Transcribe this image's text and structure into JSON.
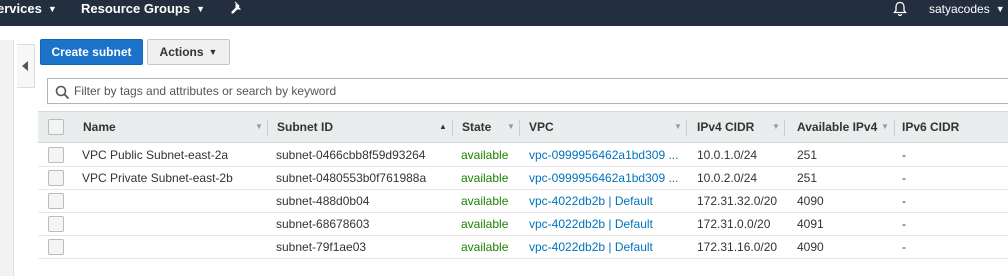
{
  "topnav": {
    "services": "ervices",
    "resource_groups": "Resource Groups",
    "username": "satyacodes"
  },
  "toolbar": {
    "create_label": "Create subnet",
    "actions_label": "Actions"
  },
  "search": {
    "placeholder": "Filter by tags and attributes or search by keyword",
    "value": ""
  },
  "table": {
    "columns": {
      "name": "Name",
      "subnet_id": "Subnet ID",
      "state": "State",
      "vpc": "VPC",
      "ipv4_cidr": "IPv4 CIDR",
      "available_ipv4": "Available IPv4",
      "ipv6_cidr": "IPv6 CIDR"
    },
    "rows": [
      {
        "name": "VPC Public Subnet-east-2a",
        "subnet_id": "subnet-0466cbb8f59d93264",
        "state": "available",
        "vpc": "vpc-0999956462a1bd309 ...",
        "ipv4_cidr": "10.0.1.0/24",
        "available_ipv4": "251",
        "ipv6_cidr": "-"
      },
      {
        "name": "VPC Private Subnet-east-2b",
        "subnet_id": "subnet-0480553b0f761988a",
        "state": "available",
        "vpc": "vpc-0999956462a1bd309 ...",
        "ipv4_cidr": "10.0.2.0/24",
        "available_ipv4": "251",
        "ipv6_cidr": "-"
      },
      {
        "name": "",
        "subnet_id": "subnet-488d0b04",
        "state": "available",
        "vpc": "vpc-4022db2b | Default",
        "ipv4_cidr": "172.31.32.0/20",
        "available_ipv4": "4090",
        "ipv6_cidr": "-"
      },
      {
        "name": "",
        "subnet_id": "subnet-68678603",
        "state": "available",
        "vpc": "vpc-4022db2b | Default",
        "ipv4_cidr": "172.31.0.0/20",
        "available_ipv4": "4091",
        "ipv6_cidr": "-"
      },
      {
        "name": "",
        "subnet_id": "subnet-79f1ae03",
        "state": "available",
        "vpc": "vpc-4022db2b | Default",
        "ipv4_cidr": "172.31.16.0/20",
        "available_ipv4": "4090",
        "ipv6_cidr": "-"
      }
    ]
  },
  "colors": {
    "topbar": "#232f3e",
    "primary_button": "#1a73c9",
    "state_available": "#1d8102",
    "link": "#0073bb"
  },
  "icons": [
    "services-chevron-icon",
    "resource-groups-chevron-icon",
    "pin-icon",
    "bell-icon",
    "user-chevron-icon",
    "collapse-arrow-icon",
    "actions-caret-icon",
    "search-icon",
    "sort-icon"
  ]
}
